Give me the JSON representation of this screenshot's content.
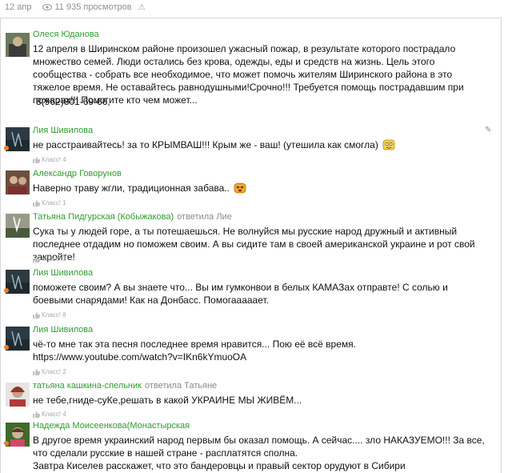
{
  "header": {
    "date": "12 апр",
    "views": "11 935 просмотров",
    "warn_glyph": "⚠"
  },
  "comments": [
    {
      "author": "Олеся Юданова",
      "reply": "",
      "text": "12 апреля в Ширинском районе произошел ужасный пожар, в результате которого пострадало множество семей. Люди остались без крова, одежды, еды и средств на жизнь. Цель этого сообщества - собрать все необходимое, что может помочь жителям Ширинского района в это тяжелое время. Не оставайтесь равнодушными!Срочно!!! Требуется помощь пострадавшим при пожарах!!! Помогите кто чем может...",
      "text2": "8(962)801-69-66,",
      "likes": ""
    },
    {
      "author": "Лия Шивилова",
      "reply": "",
      "text": "не расстраивайтесь! за то КРЫМВАШ!!! Крым же - ваш! (утешила как смогла)",
      "likes": "Класс! 4"
    },
    {
      "author": "Александр Говорунов",
      "reply": "",
      "text": "Наверно траву жгли, традиционная забава..",
      "likes": "Класс! 1"
    },
    {
      "author": "Татьяна Пидгурская (Кобыжакова)",
      "reply": "ответила Лие",
      "text": "Сука ты у людей горе, а ты потешаешься. Не волнуйся мы русские народ дружный и активный последнее отдадим но поможем своим. А вы сидите там в своей американской украине и рот свой закройте!",
      "likes": "Класс! 3"
    },
    {
      "author": "Лия Шивилова",
      "reply": "",
      "text": "поможете своим? А вы знаете что... Вы им гумконвои в белых КАМАЗах отправте! С солью и боевыми снарядами! Как на Донбасс. Помогааааает.",
      "likes": "Класс! 8"
    },
    {
      "author": "Лия Шивилова",
      "reply": "",
      "text": "чё-то мне так эта песня последнее время нравится... Пою её всё время.  https://www.youtube.com/watch?v=IKn6kYmuoOA",
      "likes": "Класс! 2"
    },
    {
      "author": "татьяна кашкина-спельник",
      "reply": "ответила Татьяне",
      "text": "не тебе,гниде-суКе,решать в какой УКРАИНЕ МЫ ЖИВЁМ...",
      "likes": "Класс! 4"
    },
    {
      "author": "Надежда Моисеенкова(Монастырская",
      "reply": "",
      "text": "В другое время украинский народ первым бы оказал помощь. А сейчас.... зло НАКАЗУЕМО!!! За все, что сделали русские в нашей стране - расплатятся сполна.",
      "text2": "Завтра Киселев расскажет, что это бандеровцы и правый сектор орудуют в Сибири",
      "likes": ""
    }
  ],
  "colors": {
    "author": "#2f9c2f",
    "online_dot": "#f27b20",
    "meta": "#8f8f8f"
  },
  "icons": [
    "eye-icon",
    "warning-icon",
    "thumb-up-icon",
    "pencil-icon",
    "emoji-icon",
    "avatar"
  ]
}
